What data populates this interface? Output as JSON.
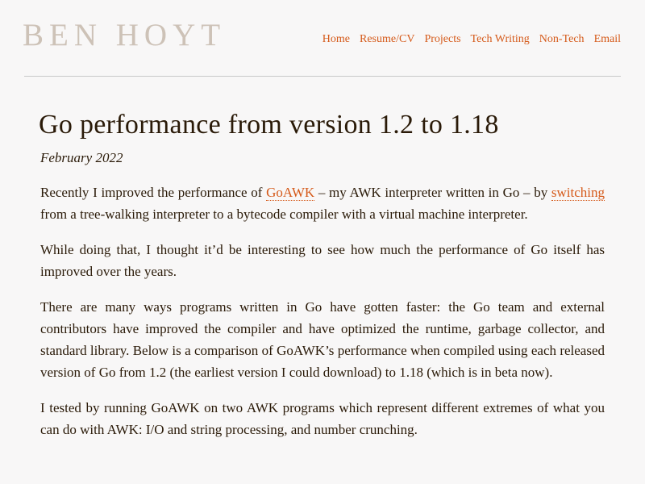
{
  "site": {
    "title": "BEN HOYT"
  },
  "nav": {
    "items": [
      "Home",
      "Resume/CV",
      "Projects",
      "Tech Writing",
      "Non-Tech",
      "Email"
    ]
  },
  "article": {
    "title": "Go performance from version 1.2 to 1.18",
    "date": "February 2022",
    "p1": {
      "before": "Recently I improved the performance of ",
      "link1": "GoAWK",
      "middle": " – my AWK interpreter written in Go – by ",
      "link2": "switching",
      "after": " from a tree-walking interpreter to a bytecode compiler with a virtual machine interpreter."
    },
    "p2": "While doing that, I thought it’d be interesting to see how much the performance of Go itself has improved over the years.",
    "p3": "There are many ways programs written in Go have gotten faster: the Go team and external contributors have improved the compiler and have optimized the runtime, garbage collector, and standard library. Below is a comparison of GoAWK’s performance when compiled using each released version of Go from 1.2 (the earliest version I could download) to 1.18 (which is in beta now).",
    "p4": "I tested by running GoAWK on two AWK programs which represent different extremes of what you can do with AWK: I/O and string processing, and number crunching."
  }
}
